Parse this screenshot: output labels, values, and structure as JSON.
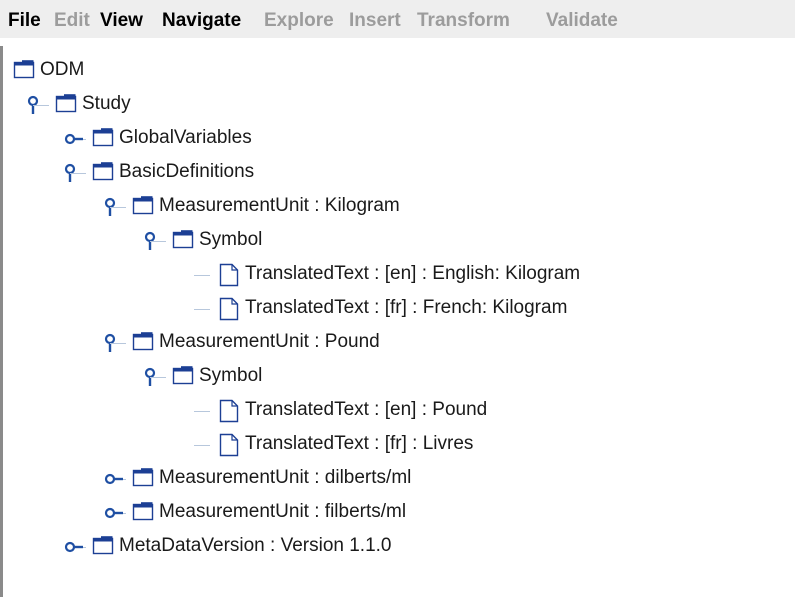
{
  "menu": [
    {
      "label": "File",
      "enabled": true
    },
    {
      "label": "Edit",
      "enabled": false
    },
    {
      "label": "View",
      "enabled": true
    },
    {
      "label": "Navigate",
      "enabled": true
    },
    {
      "label": "Explore",
      "enabled": false
    },
    {
      "label": "Insert",
      "enabled": false
    },
    {
      "label": "Transform",
      "enabled": false
    },
    {
      "label": "Validate",
      "enabled": false
    }
  ],
  "tree": [
    {
      "label": "ODM",
      "depth": 0,
      "state": "root",
      "kind": "folder"
    },
    {
      "label": "Study",
      "depth": 1,
      "state": "expanded",
      "kind": "folder"
    },
    {
      "label": "GlobalVariables",
      "depth": 2,
      "state": "collapsed",
      "kind": "folder"
    },
    {
      "label": "BasicDefinitions",
      "depth": 2,
      "state": "expanded",
      "kind": "folder"
    },
    {
      "label": "MeasurementUnit : Kilogram",
      "depth": 3,
      "state": "expanded",
      "kind": "folder"
    },
    {
      "label": "Symbol",
      "depth": 4,
      "state": "expanded",
      "kind": "folder"
    },
    {
      "label": "TranslatedText : [en] : English: Kilogram",
      "depth": 5,
      "state": "leaf",
      "kind": "file"
    },
    {
      "label": "TranslatedText : [fr] : French: Kilogram",
      "depth": 5,
      "state": "leaf",
      "kind": "file"
    },
    {
      "label": "MeasurementUnit : Pound",
      "depth": 3,
      "state": "expanded",
      "kind": "folder"
    },
    {
      "label": "Symbol",
      "depth": 4,
      "state": "expanded",
      "kind": "folder"
    },
    {
      "label": "TranslatedText : [en] : Pound",
      "depth": 5,
      "state": "leaf",
      "kind": "file"
    },
    {
      "label": "TranslatedText : [fr] : Livres",
      "depth": 5,
      "state": "leaf",
      "kind": "file"
    },
    {
      "label": "MeasurementUnit : dilberts/ml",
      "depth": 3,
      "state": "collapsed",
      "kind": "folder"
    },
    {
      "label": "MeasurementUnit : filberts/ml",
      "depth": 3,
      "state": "collapsed",
      "kind": "folder"
    },
    {
      "label": "MetaDataVersion : Version 1.1.0",
      "depth": 2,
      "state": "collapsed",
      "kind": "folder"
    }
  ],
  "icons": {
    "folder": "folder-icon",
    "file": "file-icon",
    "expanded": "tree-expanded-handle-icon",
    "collapsed": "tree-collapsed-handle-icon"
  },
  "colors": {
    "icon_blue": "#1c3f94",
    "handle_blue": "#1f4fa3",
    "disabled_text": "#9c9c9c",
    "menubar_bg": "#eeeeee"
  }
}
